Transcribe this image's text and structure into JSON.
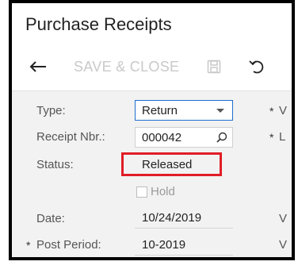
{
  "header": {
    "title": "Purchase Receipts"
  },
  "toolbar": {
    "save_close_label": "SAVE & CLOSE"
  },
  "form": {
    "type_label": "Type:",
    "type_value": "Return",
    "receipt_label": "Receipt Nbr.:",
    "receipt_value": "000042",
    "status_label": "Status:",
    "status_value": "Released",
    "hold_label": "Hold",
    "date_label": "Date:",
    "date_value": "10/24/2019",
    "post_period_label": "Post Period:",
    "post_period_value": "10-2019",
    "required_marker": "*"
  },
  "right_column": {
    "row1": "V",
    "row2": "L",
    "row3": "V",
    "row4": "V"
  }
}
